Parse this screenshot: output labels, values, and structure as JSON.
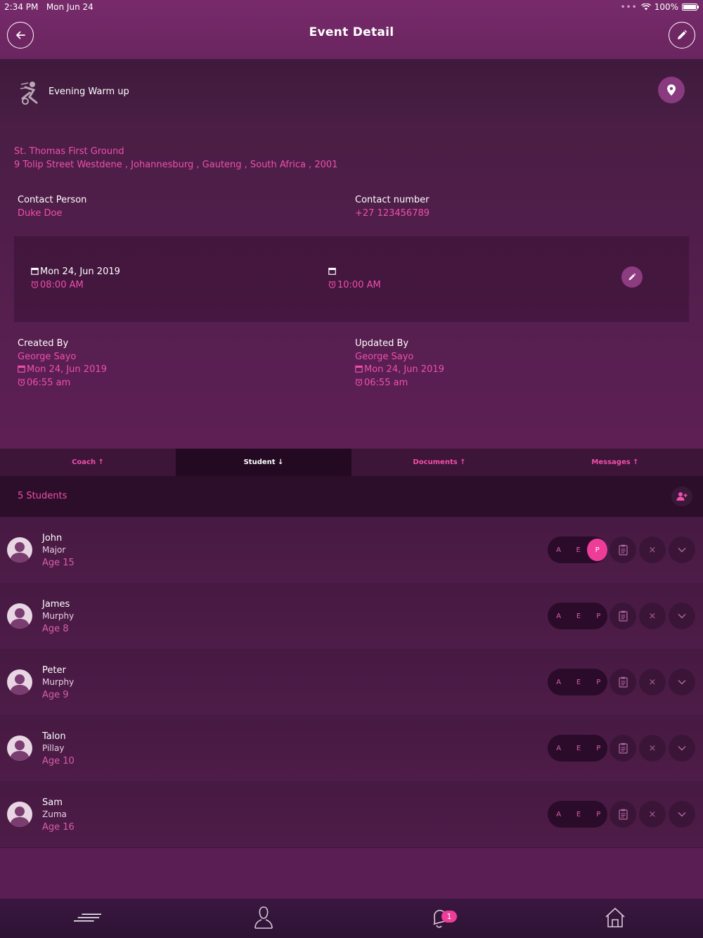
{
  "status_bar": {
    "time": "2:34 PM",
    "date": "Mon Jun 24",
    "battery": "100%"
  },
  "header": {
    "title": "Event Detail"
  },
  "event": {
    "name": "Evening Warm up",
    "venue": "St. Thomas First Ground",
    "address": "9 Tolip Street Westdene , Johannesburg , Gauteng , South Africa , 2001"
  },
  "contact": {
    "person_label": "Contact Person",
    "person": "Duke Doe",
    "number_label": "Contact number",
    "number": "+27 123456789"
  },
  "schedule": {
    "start_date": "Mon 24, Jun 2019",
    "start_time": "08:00 AM",
    "end_date": "",
    "end_time": "10:00 AM"
  },
  "audit": {
    "created_label": "Created By",
    "created_by": "George Sayo",
    "created_date": "Mon 24, Jun 2019",
    "created_time": "06:55 am",
    "updated_label": "Updated By",
    "updated_by": "George Sayo",
    "updated_date": "Mon 24, Jun 2019",
    "updated_time": "06:55 am"
  },
  "tabs": [
    {
      "label": "Coach ↑"
    },
    {
      "label": "Student ↓"
    },
    {
      "label": "Documents ↑"
    },
    {
      "label": "Messages ↑"
    }
  ],
  "active_tab": "Student",
  "students_count": "5 Students",
  "attendance": {
    "a": "A",
    "e": "E",
    "p": "P",
    "remove": "×"
  },
  "students": [
    {
      "first": "John",
      "last": "Major",
      "age": "Age 15",
      "status": "P"
    },
    {
      "first": "James",
      "last": "Murphy",
      "age": "Age 8",
      "status": ""
    },
    {
      "first": "Peter",
      "last": "Murphy",
      "age": "Age 9",
      "status": ""
    },
    {
      "first": "Talon",
      "last": "Pillay",
      "age": "Age 10",
      "status": ""
    },
    {
      "first": "Sam",
      "last": "Zuma",
      "age": "Age 16",
      "status": ""
    }
  ],
  "notifications": {
    "count": "1"
  },
  "colors": {
    "accent": "#ee3d99",
    "header": "#772a6a",
    "text_pink": "#f04fab"
  },
  "icons": [
    "back-arrow-icon",
    "pencil-icon",
    "sport-logo-icon",
    "location-pin-icon",
    "calendar-icon",
    "alarm-clock-icon",
    "add-user-icon",
    "clipboard-icon",
    "chevron-down-icon",
    "menu-lines-icon",
    "user-icon",
    "bell-icon",
    "home-icon"
  ]
}
